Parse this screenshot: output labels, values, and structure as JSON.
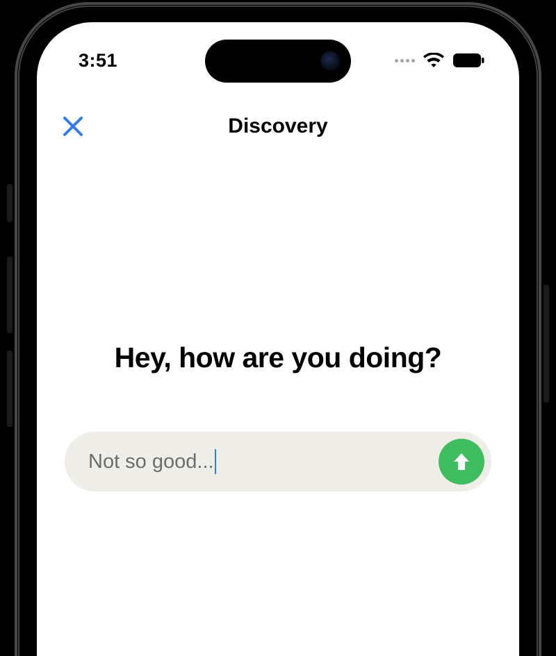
{
  "status": {
    "time": "3:51",
    "icons": {
      "cellular": "dots",
      "wifi": "wifi-icon",
      "battery": "battery-icon"
    }
  },
  "nav": {
    "close_icon": "close-icon",
    "title": "Discovery"
  },
  "prompt": {
    "text": "Hey, how are you doing?"
  },
  "input": {
    "value": "Not so good...",
    "send_icon": "arrow-up-icon"
  },
  "colors": {
    "accent_blue": "#2f7bf6",
    "send_green": "#3FBE5F",
    "input_bg": "#EEEDE8",
    "placeholder_gray": "#6c6c6c"
  }
}
